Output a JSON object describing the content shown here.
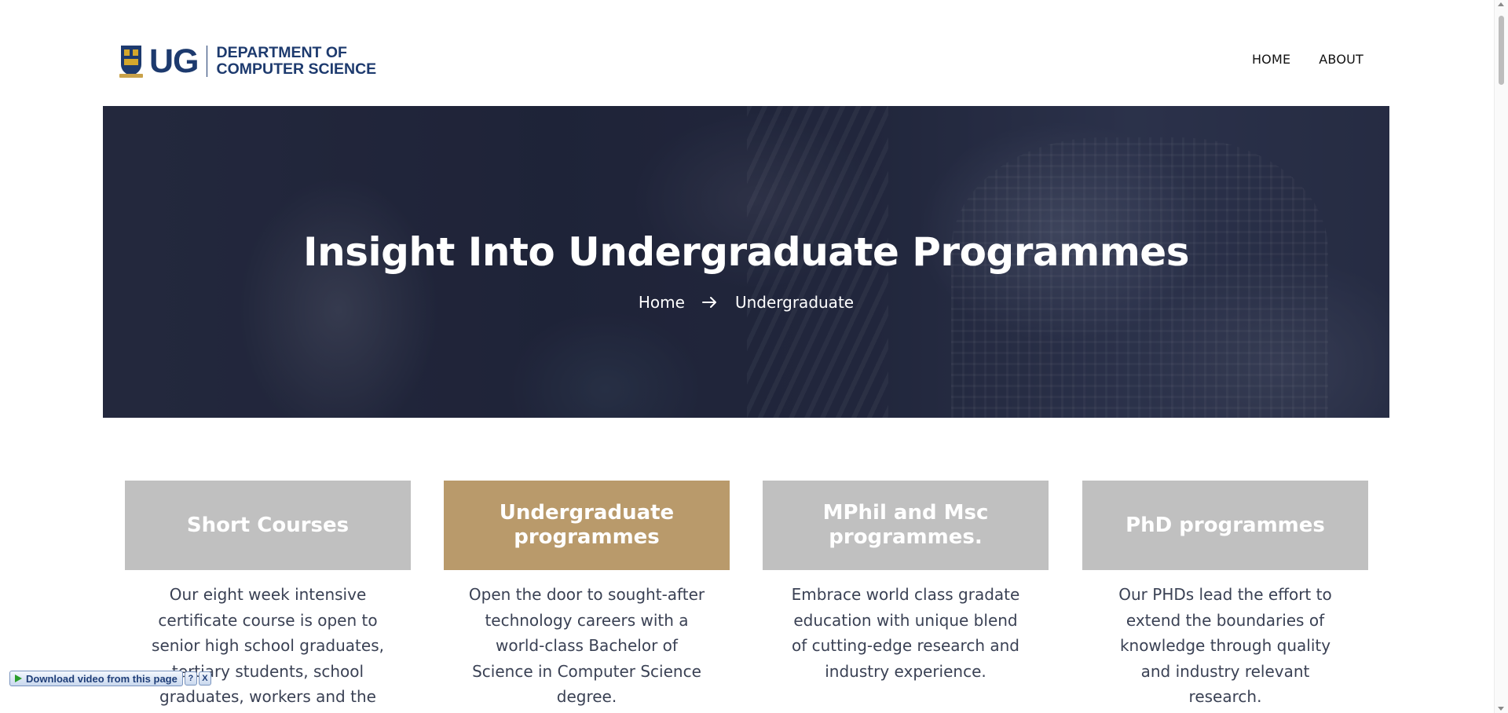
{
  "header": {
    "logo_short": "UG",
    "logo_line1": "DEPARTMENT OF",
    "logo_line2": "COMPUTER SCIENCE",
    "nav": [
      {
        "label": "HOME"
      },
      {
        "label": "ABOUT"
      }
    ]
  },
  "hero": {
    "title": "Insight Into Undergraduate Programmes",
    "breadcrumb": {
      "home": "Home",
      "separator_icon": "arrow-right-icon",
      "current": "Undergraduate"
    }
  },
  "cards": [
    {
      "title": "Short Courses",
      "body": "Our eight week intensive certificate course is open to senior high school graduates, tertiary students, school graduates, workers and the"
    },
    {
      "title": "Undergraduate programmes",
      "body": "Open the door to sought-after technology careers with a world-class Bachelor of Science in Computer Science degree.",
      "active": true
    },
    {
      "title": "MPhil and Msc programmes.",
      "body": "Embrace world class gradate education with unique blend of cutting-edge research and industry experience."
    },
    {
      "title": "PhD programmes",
      "body": "Our PHDs lead the effort to extend the boundaries of knowledge through quality and industry relevant research."
    }
  ],
  "download_bar": {
    "label": "Download video from this page",
    "help": "?",
    "close": "X"
  },
  "colors": {
    "brand_blue": "#1d3a6e",
    "card_active": "#b99a6b",
    "card_inactive": "#c0c0c0",
    "body_text": "#3a4154"
  }
}
